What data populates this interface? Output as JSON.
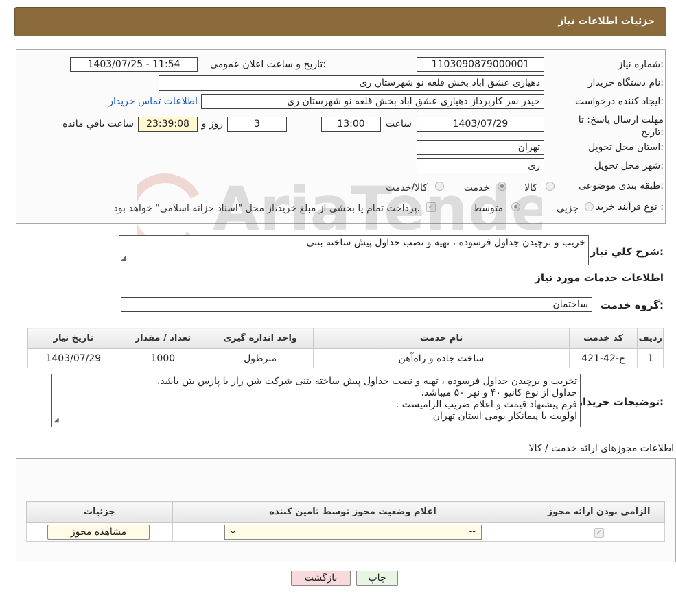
{
  "header": {
    "title": "جزئیات اطلاعات نیاز"
  },
  "form": {
    "need_number_label": "شماره نیاز:",
    "need_number": "1103090879000001",
    "announce_label": "تاریخ و ساعت اعلان عمومی:",
    "announce_value": "1403/07/25 - 11:54",
    "buyer_org_label": "نام دستگاه خریدار:",
    "buyer_org": "دهیاری عشق اباد بخش قلعه نو شهرستان ری",
    "creator_label": "ایجاد کننده درخواست:",
    "creator": "حیدر نفر کاربرداز دهیاری عشق اباد بخش قلعه نو شهرستان ری",
    "contact_link": "اطلاعات تماس خریدار",
    "deadline_label": "مهلت ارسال پاسخ: تا تاریخ:",
    "deadline_date": "1403/07/29",
    "time_label": "ساعت",
    "deadline_time": "13:00",
    "days_value": "3",
    "days_label": "روز و",
    "remaining_time": "23:39:08",
    "remaining_label": "ساعت باقي مانده",
    "province_label": "استان محل تحویل:",
    "province": "تهران",
    "city_label": "شهر محل تحویل:",
    "city": "ری",
    "category_label": "طبقه بندی موضوعی:",
    "category_options": [
      "کالا",
      "خدمت",
      "کالا/خدمت"
    ],
    "process_label": "نوع فرآیند خرید :",
    "process_options": [
      "جزیی",
      "متوسط"
    ],
    "payment_note": "پرداخت تمام یا بخشی از مبلغ خرید،از محل \"اسناد خزانه اسلامی\" خواهد بود."
  },
  "description": {
    "label": "شرح کلي نياز:",
    "text": "خریب و برچیدن جداول فرسوده ، تهیه و نصب جداول پیش ساخته بتنی"
  },
  "services": {
    "section_title": "اطلاعات خدمات مورد نیاز",
    "group_label": "گروه خدمت:",
    "group_value": "ساختمان",
    "columns": [
      "ردیف",
      "کد خدمت",
      "نام خدمت",
      "واحد اندازه گیری",
      "تعداد / مقدار",
      "تاریخ نیاز"
    ],
    "rows": [
      {
        "row": "1",
        "code": "ج-42-421",
        "name": "ساخت جاده و راه‌آهن",
        "unit": "مترطول",
        "qty": "1000",
        "date": "1403/07/29"
      }
    ]
  },
  "buyer_notes": {
    "label": "توضیحات خریدار:",
    "lines": [
      "تخریب و برچیدن جداول فرسوده ، تهیه و نصب جداول پیش ساخته بتنی شرکت شن زار یا پارس بتن باشد.",
      "جداول از نوع کانیو ۴۰ و نهر ۵۰ میباشد.",
      "فرم پیشنهاد قیمت و اعلام ضریب الزامیست .",
      "اولویت با پیمانکار بومی استان تهران"
    ]
  },
  "permits": {
    "section_title": "اطلاعات مجوزهای ارائه خدمت / کالا",
    "columns": [
      "الزامی بودن ارائه مجوز",
      "اعلام وضعیت مجوز توسط تامین کننده",
      "جزئیات"
    ],
    "select_value": "--",
    "view_button": "مشاهده مجوز"
  },
  "buttons": {
    "print": "چاپ",
    "back": "بازگشت"
  },
  "watermark": {
    "text": "AriaTender.neT"
  },
  "colors": {
    "header": "#8b6a3c",
    "link": "#1a56c9",
    "back_button": "#f8d9dc",
    "print_button": "#e8f5e2"
  }
}
